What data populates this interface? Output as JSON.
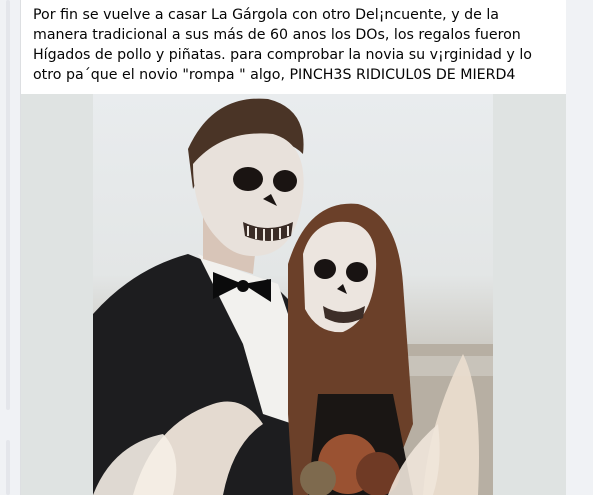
{
  "post": {
    "text": "Por fin se vuelve a casar La Gárgola con otro Del¡ncuente, y de la manera tradicional a sus más de 60 anos los DOs, los regalos fueron Hígados de pollo y piñatas. para comprobar la novia su v¡rginidad y lo otro pa´que el novio \"rompa \" algo, PINCH3S RIDICUL0S DE MIERD4"
  },
  "colors": {
    "page_bg": "#f0f2f5",
    "card_bg": "#ffffff",
    "text": "#050505",
    "media_bg": "#dfe3e2"
  }
}
